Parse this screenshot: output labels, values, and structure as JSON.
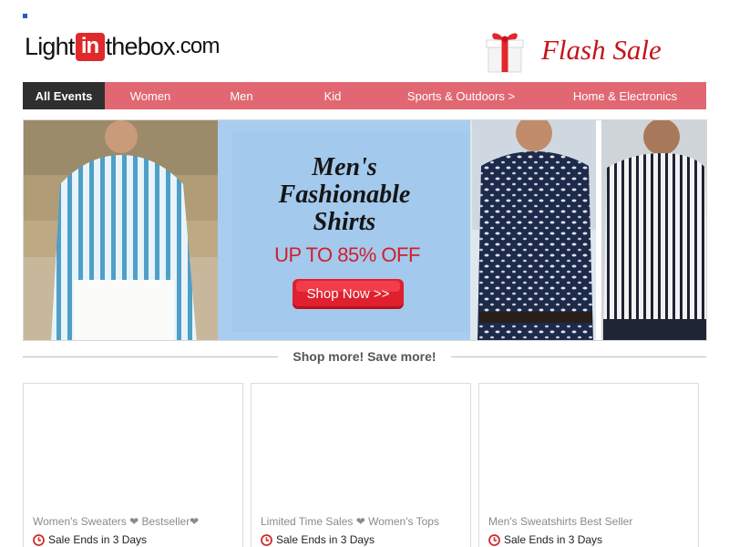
{
  "header": {
    "logo": {
      "light": "Light",
      "in": "in",
      "thebox": "thebox",
      "dotcom": ".com"
    },
    "flash_sale": "Flash Sale"
  },
  "nav": {
    "items": [
      {
        "label": "All Events",
        "active": true
      },
      {
        "label": "Women"
      },
      {
        "label": "Men"
      },
      {
        "label": "Kid"
      },
      {
        "label": "Sports & Outdoors >"
      },
      {
        "label": "Home & Electronics"
      }
    ]
  },
  "banner": {
    "title_line1": "Men's",
    "title_line2": "Fashionable",
    "title_line3": "Shirts",
    "discount": "UP TO 85% OFF",
    "cta": "Shop Now >>"
  },
  "section": {
    "label": "Shop more! Save more!"
  },
  "cards": [
    {
      "title": "Women's Sweaters ❤ Bestseller❤",
      "countdown": "Sale Ends in 3 Days"
    },
    {
      "title": "Limited Time Sales ❤ Women's Tops",
      "countdown": "Sale Ends in 3 Days"
    },
    {
      "title": "Men's Sweatshirts Best Seller",
      "countdown": "Sale Ends in 3 Days"
    }
  ],
  "colors": {
    "nav_bg": "#e16873",
    "nav_active": "#2f2f2f",
    "brand_red": "#e0292b",
    "flash_red": "#c4141b",
    "banner_blue": "#a9cdef",
    "cta_red": "#e0202e"
  },
  "icons": {
    "gift": "gift-box-icon",
    "clock": "clock-icon",
    "heart": "heart-icon"
  }
}
